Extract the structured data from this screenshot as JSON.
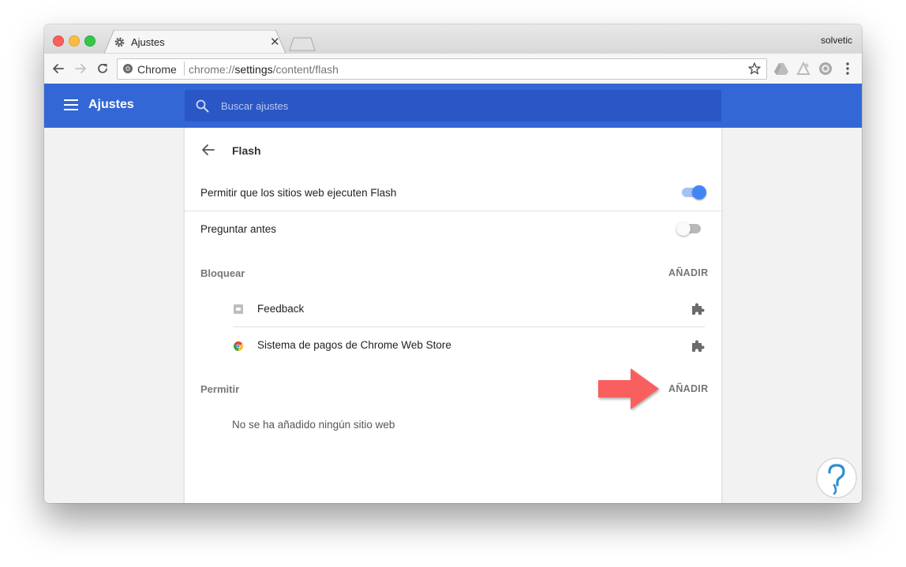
{
  "tab": {
    "title": "Ajustes",
    "close_glyph": "✕",
    "icon": "gear-icon"
  },
  "profile": {
    "name": "solvetic"
  },
  "omnibox": {
    "origin_label": "Chrome",
    "url_scheme": "chrome://",
    "url_host": "settings",
    "url_path": "/content/flash"
  },
  "header": {
    "title": "Ajustes",
    "search_placeholder": "Buscar ajustes",
    "color": "#3367d6"
  },
  "page": {
    "title": "Flash",
    "allow_flash": {
      "label": "Permitir que los sitios web ejecuten Flash",
      "enabled": true
    },
    "ask_first": {
      "label": "Preguntar antes",
      "enabled": false
    },
    "block": {
      "title": "Bloquear",
      "add_label": "AÑADIR",
      "sites": [
        {
          "label": "Feedback",
          "icon": "feedback-icon",
          "action_icon": "puzzle-icon"
        },
        {
          "label": "Sistema de pagos de Chrome Web Store",
          "icon": "chrome-webstore-icon",
          "action_icon": "puzzle-icon"
        }
      ]
    },
    "allow": {
      "title": "Permitir",
      "add_label": "AÑADIR",
      "empty_message": "No se ha añadido ningún sitio web"
    }
  },
  "colors": {
    "accent": "#4285f4",
    "annotation_arrow": "#f95f5f"
  }
}
